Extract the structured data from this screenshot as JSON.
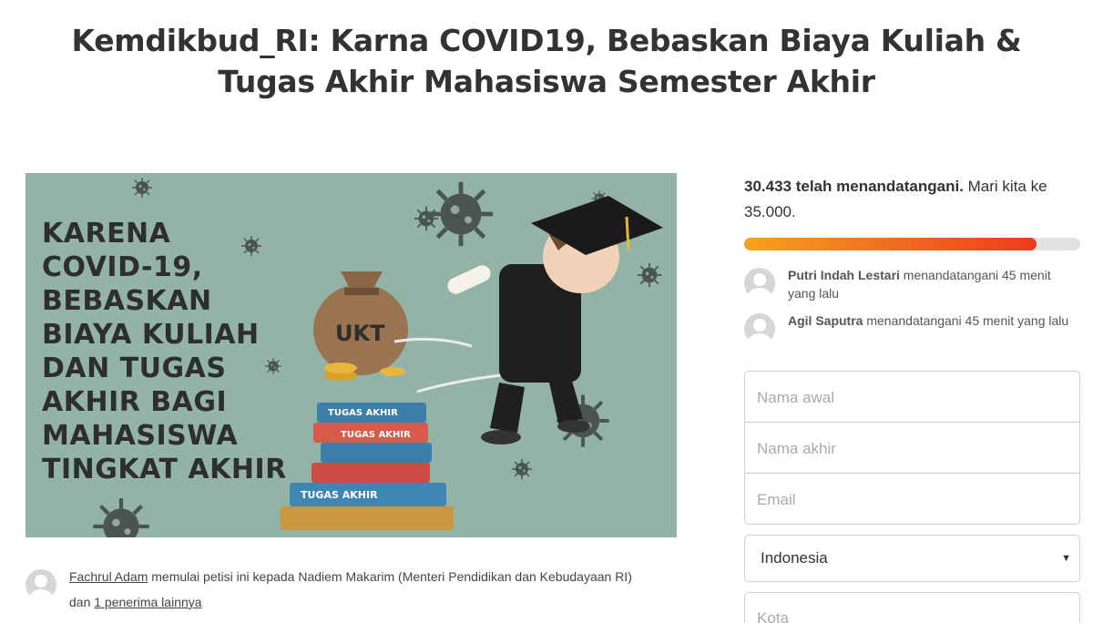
{
  "petition": {
    "title": "Kemdikbud_RI: Karna COVID19, Bebaskan Biaya Kuliah & Tugas Akhir Mahasiswa Semester Akhir"
  },
  "hero_image": {
    "text_lines": [
      "KARENA",
      "COVID-19,",
      "BEBASKAN",
      "BIAYA KULIAH",
      "DAN TUGAS",
      "AKHIR BAGI",
      "MAHASISWA",
      "TINGKAT AKHIR"
    ],
    "bag_label": "UKT",
    "book_labels": [
      "TUGAS AKHIR",
      "TUGAS AKHIR",
      "TUGAS AKHIR"
    ],
    "colors": {
      "background": "#93b3a6",
      "text": "#2e2e2e",
      "virus": "#4a5552"
    }
  },
  "starter": {
    "name": "Fachrul Adam",
    "middle": " memulai petisi ini kepada Nadiem Makarim (Menteri Pendidikan dan Kebudayaan RI) dan ",
    "other_link": "1 penerima lainnya"
  },
  "signatures": {
    "count_text": "30.433 telah menandatangani.",
    "goal_text": " Mari kita ke 35.000.",
    "progress_fraction": 0.8695,
    "colors": {
      "start": "#f7a21b",
      "end": "#ed3a1f",
      "track": "#e1e1e1"
    }
  },
  "recent_signers": [
    {
      "name": "Putri Indah Lestari",
      "action": " menandatangani 45 menit yang lalu"
    },
    {
      "name": "Agil Saputra",
      "action": " menandatangani 45 menit yang lalu"
    }
  ],
  "form": {
    "first_name_placeholder": "Nama awal",
    "last_name_placeholder": "Nama akhir",
    "email_placeholder": "Email",
    "country_value": "Indonesia",
    "city_placeholder": "Kota"
  }
}
